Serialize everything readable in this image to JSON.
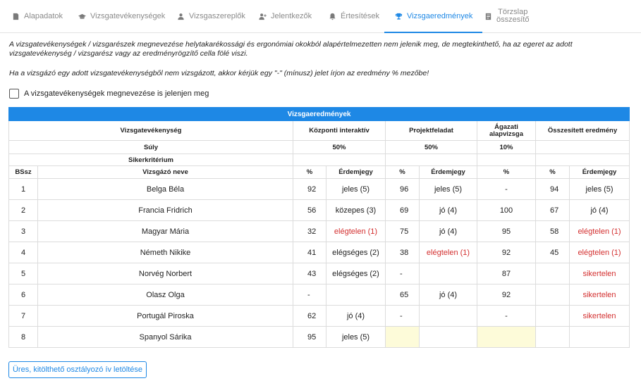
{
  "tabs": [
    {
      "label": "Alapadatok",
      "icon": "document-icon"
    },
    {
      "label": "Vizsgatevékenységek",
      "icon": "graduation-cap-icon"
    },
    {
      "label": "Vizsgaszereplők",
      "icon": "person-icon"
    },
    {
      "label": "Jelentkezők",
      "icon": "add-person-icon"
    },
    {
      "label": "Értesítések",
      "icon": "bell-icon"
    },
    {
      "label": "Vizsgaeredmények",
      "icon": "trophy-icon"
    },
    {
      "label_line1": "Törzslap",
      "label_line2": "összesítő",
      "icon": "list-icon"
    }
  ],
  "active_tab": "Vizsgaeredmények",
  "notes": {
    "line1": "A vizsgatevékenységek / vizsgarészek megnevezése helytakarékossági és ergonómiai okokból alapértelmezetten nem jelenik meg, de megtekinthető, ha az egeret az adott",
    "line2": "vizsgatevékenység / vizsgarész vagy az eredményrögzítő cella fölé viszi.",
    "line3": "Ha a vizsgázó egy adott vizsgatevékenységből nem vizsgázott, akkor kérjük egy \"-\" (mínusz) jelet írjon az eredmény % mezőbe!"
  },
  "show_names_checkbox": {
    "label": "A vizsgatevékenységek megnevezése is jelenjen meg",
    "checked": false
  },
  "table": {
    "caption": "Vizsgaeredmények",
    "activity_header": "Vizsgatevékenység",
    "col_kozponti": "Központi interaktív",
    "col_projekt": "Projektfeladat",
    "col_agazati_1": "Ágazati",
    "col_agazati_2": "alapvizsga",
    "col_osszesitett": "Összesített eredmény",
    "weight_label": "Súly",
    "weight_kozponti": "50%",
    "weight_projekt": "50%",
    "weight_agazati": "10%",
    "criterion_label": "Sikerkritérium",
    "h_bssz": "BSsz",
    "h_name": "Vizsgázó neve",
    "h_pct": "%",
    "h_grade": "Érdemjegy",
    "rows": [
      {
        "n": "1",
        "name": "Belga Béla",
        "k_pct": "92",
        "k_grade": "jeles (5)",
        "p_pct": "96",
        "p_grade": "jeles (5)",
        "a_pct": "-",
        "o_pct": "94",
        "o_grade": "jeles (5)",
        "fail_k": false,
        "fail_p": false,
        "fail_o": false
      },
      {
        "n": "2",
        "name": "Francia Fridrich",
        "k_pct": "56",
        "k_grade": "közepes (3)",
        "p_pct": "69",
        "p_grade": "jó (4)",
        "a_pct": "100",
        "o_pct": "67",
        "o_grade": "jó (4)",
        "fail_k": false,
        "fail_p": false,
        "fail_o": false
      },
      {
        "n": "3",
        "name": "Magyar Mária",
        "k_pct": "32",
        "k_grade": "elégtelen (1)",
        "p_pct": "75",
        "p_grade": "jó (4)",
        "a_pct": "95",
        "o_pct": "58",
        "o_grade": "elégtelen (1)",
        "fail_k": true,
        "fail_p": false,
        "fail_o": true
      },
      {
        "n": "4",
        "name": "Németh Nikike",
        "k_pct": "41",
        "k_grade": "elégséges (2)",
        "p_pct": "38",
        "p_grade": "elégtelen (1)",
        "a_pct": "92",
        "o_pct": "45",
        "o_grade": "elégtelen (1)",
        "fail_k": false,
        "fail_p": true,
        "fail_o": true
      },
      {
        "n": "5",
        "name": "Norvég Norbert",
        "k_pct": "43",
        "k_grade": "elégséges (2)",
        "p_pct": "-",
        "p_grade": "",
        "a_pct": "87",
        "o_pct": "",
        "o_grade": "sikertelen",
        "fail_k": false,
        "fail_p": false,
        "fail_o": true
      },
      {
        "n": "6",
        "name": "Olasz Olga",
        "k_pct": "-",
        "k_grade": "",
        "p_pct": "65",
        "p_grade": "jó (4)",
        "a_pct": "92",
        "o_pct": "",
        "o_grade": "sikertelen",
        "fail_k": false,
        "fail_p": false,
        "fail_o": true
      },
      {
        "n": "7",
        "name": "Portugál Piroska",
        "k_pct": "62",
        "k_grade": "jó (4)",
        "p_pct": "-",
        "p_grade": "",
        "a_pct": "-",
        "o_pct": "",
        "o_grade": "sikertelen",
        "fail_k": false,
        "fail_p": false,
        "fail_o": true
      },
      {
        "n": "8",
        "name": "Spanyol Sárika",
        "k_pct": "95",
        "k_grade": "jeles (5)",
        "p_pct": "",
        "p_grade": "",
        "a_pct": "",
        "o_pct": "",
        "o_grade": "",
        "fail_k": false,
        "fail_p": false,
        "fail_o": false,
        "empty_p": true,
        "empty_a": true
      }
    ]
  },
  "download_button": "Üres, kitölthető osztályozó ív letöltése",
  "colors": {
    "accent": "#1e88e5",
    "fail": "#d32f2f",
    "empty_cell": "#fdfbd9"
  }
}
